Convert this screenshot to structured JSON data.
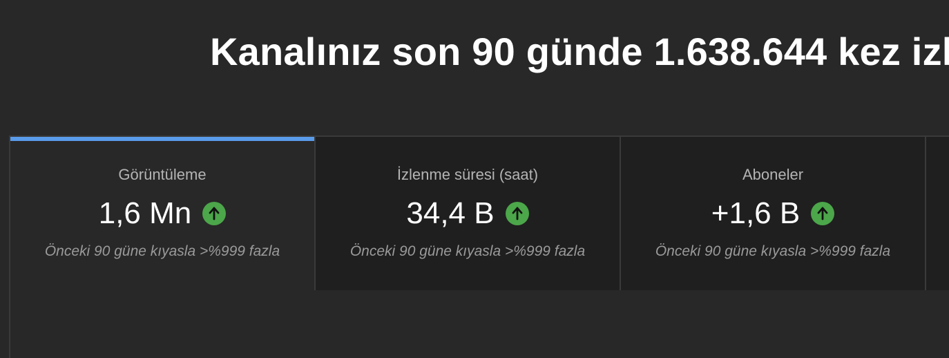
{
  "headline": "Kanalınız son 90 günde 1.638.644 kez izl",
  "metrics": [
    {
      "label": "Görüntüleme",
      "value": "1,6 Mn",
      "trend_icon": "arrow-up-icon",
      "comparison": "Önceki 90 güne kıyasla >%999 fazla",
      "selected": true
    },
    {
      "label": "İzlenme süresi (saat)",
      "value": "34,4 B",
      "trend_icon": "arrow-up-icon",
      "comparison": "Önceki 90 güne kıyasla >%999 fazla",
      "selected": false
    },
    {
      "label": "Aboneler",
      "value": "+1,6 B",
      "trend_icon": "arrow-up-icon",
      "comparison": "Önceki 90 güne kıyasla >%999 fazla",
      "selected": false
    }
  ],
  "colors": {
    "background": "#282828",
    "inactive_tab": "#1f1f1f",
    "active_indicator": "#5a9bea",
    "trend_up": "#4ca64a"
  }
}
